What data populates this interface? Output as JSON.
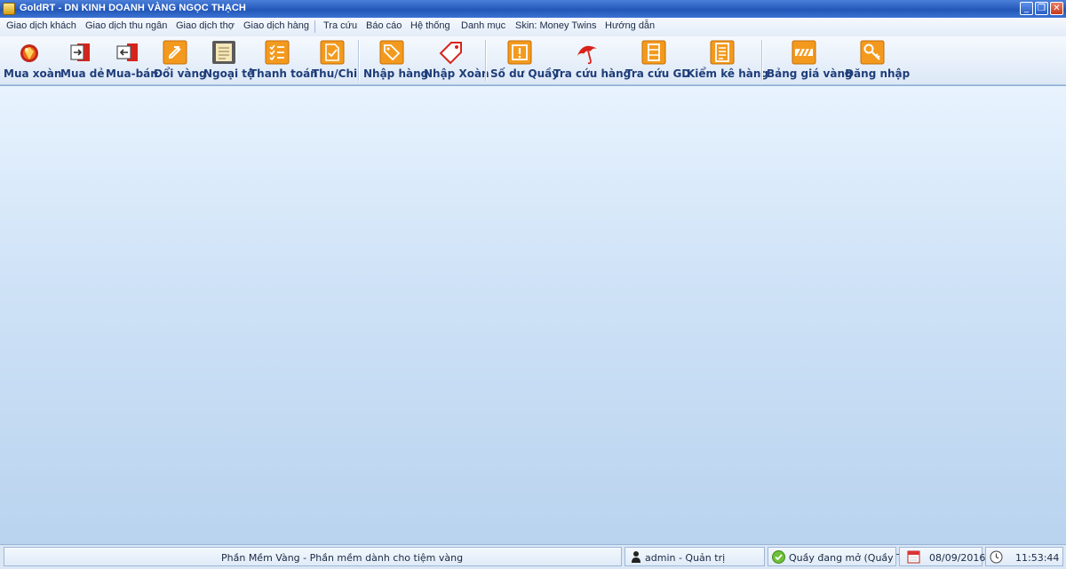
{
  "window": {
    "title": "GoldRT - DN KINH DOANH VÀNG NGỌC THẠCH"
  },
  "menu": {
    "items": [
      "Giao dịch khách",
      "Giao dịch thu ngân",
      "Giao dịch thợ",
      "Giao dịch hàng",
      "Tra cứu",
      "Báo cáo",
      "Hệ thống",
      "Danh mục",
      "Skin: Money Twins",
      "Hướng dẫn"
    ]
  },
  "toolbar": {
    "buttons": [
      {
        "label": "Mua xoàn",
        "icon": "diamond-icon"
      },
      {
        "label": "Mua dẻ",
        "icon": "exit-red-icon"
      },
      {
        "label": "Mua-bán",
        "icon": "enter-red-icon"
      },
      {
        "label": "Đổi vàng",
        "icon": "exchange-icon"
      },
      {
        "label": "Ngoại tệ",
        "icon": "ledger-icon"
      },
      {
        "label": "Thanh toán",
        "icon": "checklist-icon"
      },
      {
        "label": "Thu/Chi",
        "icon": "document-check-icon"
      },
      {
        "label": "Nhập hàng",
        "icon": "tag-orange-icon"
      },
      {
        "label": "Nhập Xoàn",
        "icon": "tag-red-icon"
      },
      {
        "label": "Số dư Quầy",
        "icon": "alert-icon"
      },
      {
        "label": "Tra cứu hàng",
        "icon": "umbrella-icon"
      },
      {
        "label": "Tra cứu GD",
        "icon": "list-box-icon"
      },
      {
        "label": "Kiểm kê hàng",
        "icon": "inventory-icon"
      },
      {
        "label": "Bảng giá vàng",
        "icon": "price-board-icon"
      },
      {
        "label": "Đăng nhập",
        "icon": "key-icon"
      }
    ]
  },
  "status": {
    "app_desc": "Phần Mềm Vàng - Phần mềm dành cho tiệm vàng",
    "user": "admin - Quản trị",
    "counter": "Quầy đang mở (Quầy Test)",
    "date": "08/09/2016",
    "time": "11:53:44"
  },
  "colors": {
    "title_blue": "#2b5fc0",
    "icon_orange": "#f39a1e",
    "label_navy": "#1f3d7a"
  }
}
